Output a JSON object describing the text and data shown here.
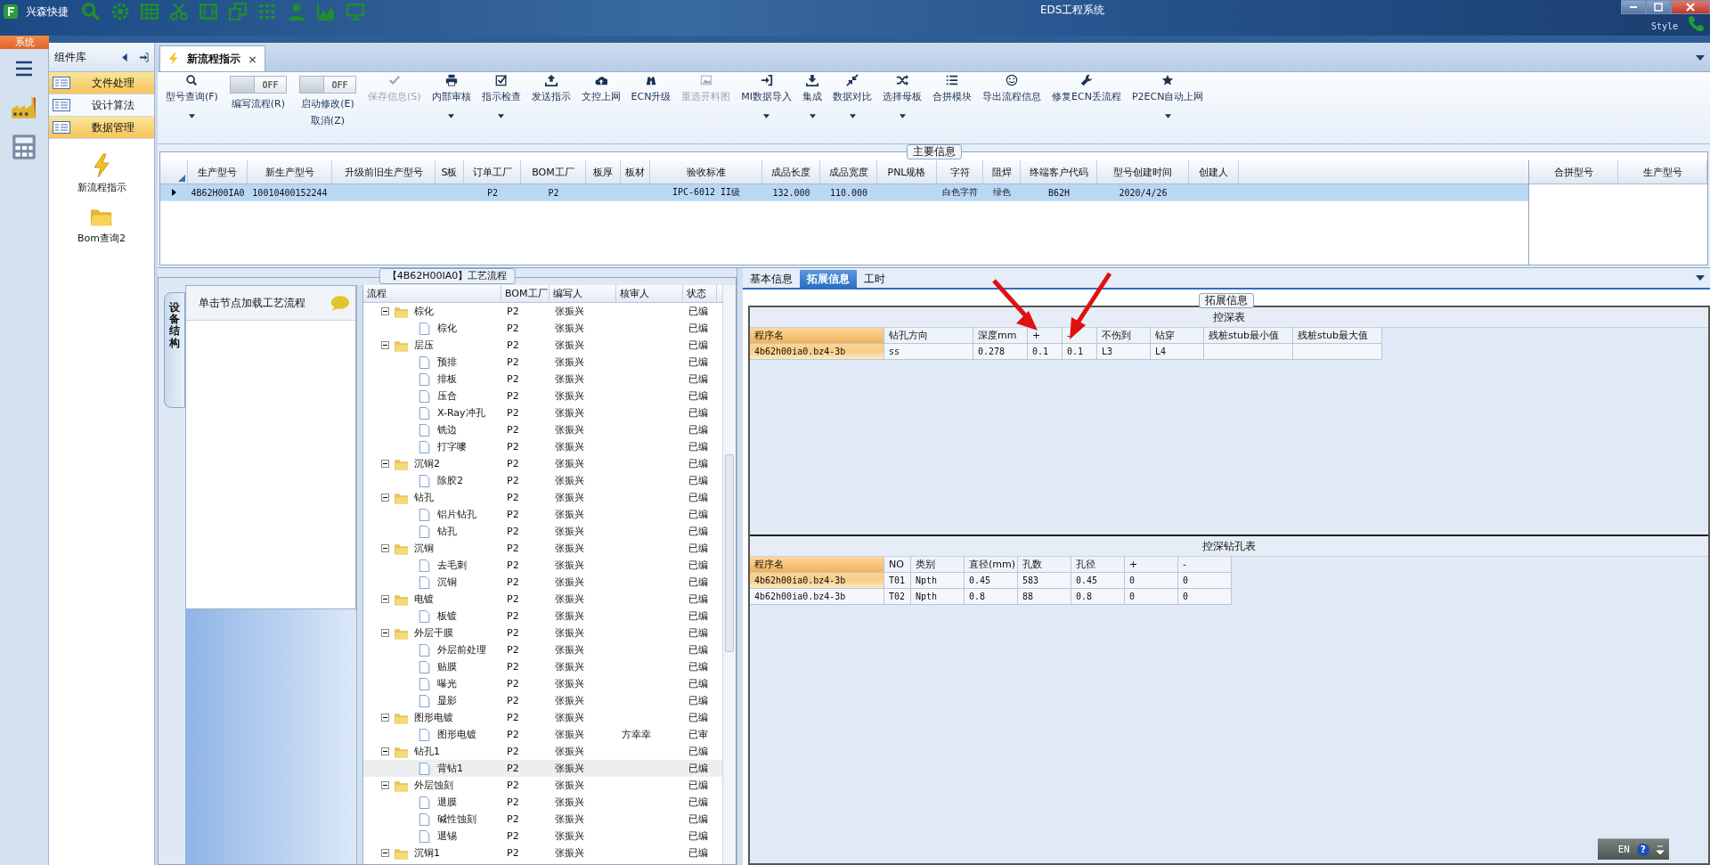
{
  "window": {
    "title": "EDS工程系统",
    "quick_access": "兴森快捷",
    "style_menu": "Style",
    "system_tab": "系统"
  },
  "component_library": {
    "title": "组件库",
    "items": [
      {
        "label": "文件处理",
        "selected": true
      },
      {
        "label": "设计算法",
        "selected": false
      },
      {
        "label": "数据管理",
        "selected": true
      }
    ],
    "launchers": [
      "新流程指示",
      "Bom查询2"
    ]
  },
  "document_tab": {
    "label": "新流程指示",
    "close": "×"
  },
  "ribbon": [
    {
      "kind": "button",
      "label": "型号查询(F)",
      "disabled": false,
      "dropdown": true
    },
    {
      "kind": "toggle",
      "label": "编写流程(R)",
      "toggle_text": "OFF",
      "on": false
    },
    {
      "kind": "toggle",
      "label": "启动修改(E)",
      "sublabel": "取消(Z)",
      "toggle_text": "OFF",
      "on": false
    },
    {
      "kind": "button",
      "label": "保存信息(S)",
      "disabled": true,
      "dropdown": false
    },
    {
      "kind": "button",
      "label": "内部审核",
      "disabled": false,
      "dropdown": true
    },
    {
      "kind": "button",
      "label": "指示检查",
      "disabled": false,
      "dropdown": true
    },
    {
      "kind": "button",
      "label": "发送指示",
      "disabled": false,
      "dropdown": false
    },
    {
      "kind": "button",
      "label": "文控上网",
      "disabled": false,
      "dropdown": false
    },
    {
      "kind": "button",
      "label": "ECN升级",
      "disabled": false,
      "dropdown": false
    },
    {
      "kind": "button",
      "label": "重选开料图",
      "disabled": true,
      "dropdown": false
    },
    {
      "kind": "button",
      "label": "MI数据导入",
      "disabled": false,
      "dropdown": true
    },
    {
      "kind": "button",
      "label": "集成",
      "disabled": false,
      "dropdown": true
    },
    {
      "kind": "button",
      "label": "数据对比",
      "disabled": false,
      "dropdown": true
    },
    {
      "kind": "button",
      "label": "选择母板",
      "disabled": false,
      "dropdown": true
    },
    {
      "kind": "button",
      "label": "合拼模块",
      "disabled": false,
      "dropdown": false
    },
    {
      "kind": "button",
      "label": "导出流程信息",
      "disabled": false,
      "dropdown": false
    },
    {
      "kind": "button",
      "label": "修复ECN丢流程",
      "disabled": false,
      "dropdown": false
    },
    {
      "kind": "button",
      "label": "P2ECN自动上网",
      "disabled": false,
      "dropdown": true
    }
  ],
  "main_info": {
    "title": "主要信息",
    "columns": [
      "生产型号",
      "新生产型号",
      "升级前旧生产型号",
      "S板",
      "订单工厂",
      "BOM工厂",
      "板厚",
      "板材",
      "验收标准",
      "成品长度",
      "成品宽度",
      "PNL规格",
      "字符",
      "阻焊",
      "终端客户代码",
      "型号创建时间",
      "创建人"
    ],
    "rows": [
      {
        "selected": true,
        "cells": [
          "4B62H00IA0",
          "10010400152244",
          null,
          null,
          "P2",
          "P2",
          null,
          null,
          "IPC-6012 II级",
          "132.000",
          "110.000",
          null,
          "白色字符",
          "绿色",
          "B62H",
          "2020/4/26",
          null
        ]
      }
    ],
    "side_columns": [
      "合拼型号",
      "生产型号"
    ]
  },
  "process_flow": {
    "title": "【4B62H00IA0】工艺流程",
    "side_tab": "设备结构",
    "hint": "单击节点加载工艺流程",
    "columns": [
      "流程",
      "BOM工厂",
      "编写人",
      "核审人",
      "状态"
    ],
    "tree": [
      {
        "name": "棕化",
        "bom": "P2",
        "writer": "张振兴",
        "status": "已编",
        "selected": false,
        "expanded": true,
        "children": [
          {
            "name": "棕化",
            "bom": "P2",
            "writer": "张振兴",
            "status": "已编",
            "selected": false
          }
        ]
      },
      {
        "name": "层压",
        "bom": "P2",
        "writer": "张振兴",
        "status": "已编",
        "selected": false,
        "expanded": true,
        "children": [
          {
            "name": "预排",
            "bom": "P2",
            "writer": "张振兴",
            "status": "已编",
            "selected": false
          },
          {
            "name": "排板",
            "bom": "P2",
            "writer": "张振兴",
            "status": "已编",
            "selected": false
          },
          {
            "name": "压合",
            "bom": "P2",
            "writer": "张振兴",
            "status": "已编",
            "selected": false
          },
          {
            "name": "X-Ray冲孔",
            "bom": "P2",
            "writer": "张振兴",
            "status": "已编",
            "selected": false
          },
          {
            "name": "铣边",
            "bom": "P2",
            "writer": "张振兴",
            "status": "已编",
            "selected": false
          },
          {
            "name": "打字嘜",
            "bom": "P2",
            "writer": "张振兴",
            "status": "已编",
            "selected": false
          }
        ]
      },
      {
        "name": "沉铜2",
        "bom": "P2",
        "writer": "张振兴",
        "status": "已编",
        "selected": false,
        "expanded": true,
        "children": [
          {
            "name": "除胶2",
            "bom": "P2",
            "writer": "张振兴",
            "status": "已编",
            "selected": false
          }
        ]
      },
      {
        "name": "钻孔",
        "bom": "P2",
        "writer": "张振兴",
        "status": "已编",
        "selected": false,
        "expanded": true,
        "children": [
          {
            "name": "铝片钻孔",
            "bom": "P2",
            "writer": "张振兴",
            "status": "已编",
            "selected": false
          },
          {
            "name": "钻孔",
            "bom": "P2",
            "writer": "张振兴",
            "status": "已编",
            "selected": false
          }
        ]
      },
      {
        "name": "沉铜",
        "bom": "P2",
        "writer": "张振兴",
        "status": "已编",
        "selected": false,
        "expanded": true,
        "children": [
          {
            "name": "去毛刺",
            "bom": "P2",
            "writer": "张振兴",
            "status": "已编",
            "selected": false
          },
          {
            "name": "沉铜",
            "bom": "P2",
            "writer": "张振兴",
            "status": "已编",
            "selected": false
          }
        ]
      },
      {
        "name": "电镀",
        "bom": "P2",
        "writer": "张振兴",
        "status": "已编",
        "selected": false,
        "expanded": true,
        "children": [
          {
            "name": "板镀",
            "bom": "P2",
            "writer": "张振兴",
            "status": "已编",
            "selected": false
          }
        ]
      },
      {
        "name": "外层干膜",
        "bom": "P2",
        "writer": "张振兴",
        "status": "已编",
        "selected": false,
        "expanded": true,
        "children": [
          {
            "name": "外层前处理",
            "bom": "P2",
            "writer": "张振兴",
            "status": "已编",
            "selected": false
          },
          {
            "name": "贴膜",
            "bom": "P2",
            "writer": "张振兴",
            "status": "已编",
            "selected": false
          },
          {
            "name": "曝光",
            "bom": "P2",
            "writer": "张振兴",
            "status": "已编",
            "selected": false
          },
          {
            "name": "显影",
            "bom": "P2",
            "writer": "张振兴",
            "status": "已编",
            "selected": false
          }
        ]
      },
      {
        "name": "图形电镀",
        "bom": "P2",
        "writer": "张振兴",
        "status": "已编",
        "selected": false,
        "expanded": true,
        "children": [
          {
            "name": "图形电镀",
            "bom": "P2",
            "writer": "张振兴",
            "reviewer": "方幸幸",
            "status": "已审",
            "selected": false
          }
        ]
      },
      {
        "name": "钻孔1",
        "bom": "P2",
        "writer": "张振兴",
        "status": "已编",
        "selected": false,
        "expanded": true,
        "children": [
          {
            "name": "背钻1",
            "bom": "P2",
            "writer": "张振兴",
            "status": "已编",
            "selected": true
          }
        ]
      },
      {
        "name": "外层蚀刻",
        "bom": "P2",
        "writer": "张振兴",
        "status": "已编",
        "selected": false,
        "expanded": true,
        "children": [
          {
            "name": "退膜",
            "bom": "P2",
            "writer": "张振兴",
            "status": "已编",
            "selected": false
          },
          {
            "name": "碱性蚀刻",
            "bom": "P2",
            "writer": "张振兴",
            "status": "已编",
            "selected": false
          },
          {
            "name": "退锡",
            "bom": "P2",
            "writer": "张振兴",
            "status": "已编",
            "selected": false
          }
        ]
      },
      {
        "name": "沉铜1",
        "bom": "P2",
        "writer": "张振兴",
        "status": "已编",
        "selected": false,
        "expanded": true
      }
    ]
  },
  "detail": {
    "tabs": [
      {
        "label": "基本信息",
        "selected": false
      },
      {
        "label": "拓展信息",
        "selected": true
      },
      {
        "label": "工时",
        "selected": false
      }
    ],
    "group_title": "拓展信息",
    "depth_table": {
      "title": "控深表",
      "columns": [
        "程序名",
        "钻孔方向",
        "深度mm",
        "+",
        "-",
        "不伤到",
        "钻穿",
        "残桩stub最小值",
        "残桩stub最大值"
      ],
      "rows": [
        {
          "selected": true,
          "cells": [
            "4b62h00ia0.bz4-3b",
            "ss",
            "0.278",
            "0.1",
            "0.1",
            "L3",
            "L4",
            null,
            null
          ]
        }
      ]
    },
    "hole_table": {
      "title": "控深钻孔表",
      "columns": [
        "程序名",
        "NO",
        "类别",
        "直径(mm)",
        "孔数",
        "孔径",
        "+",
        "-"
      ],
      "rows": [
        {
          "selected": true,
          "cells": [
            "4b62h00ia0.bz4-3b",
            "T01",
            "Npth",
            "0.45",
            "583",
            "0.45",
            "0",
            "0"
          ]
        },
        {
          "selected": false,
          "cells": [
            "4b62h00ia0.bz4-3b",
            "T02",
            "Npth",
            "0.8",
            "88",
            "0.8",
            "0",
            "0"
          ]
        }
      ]
    }
  },
  "language_bar": {
    "label": "EN",
    "help": "?"
  }
}
